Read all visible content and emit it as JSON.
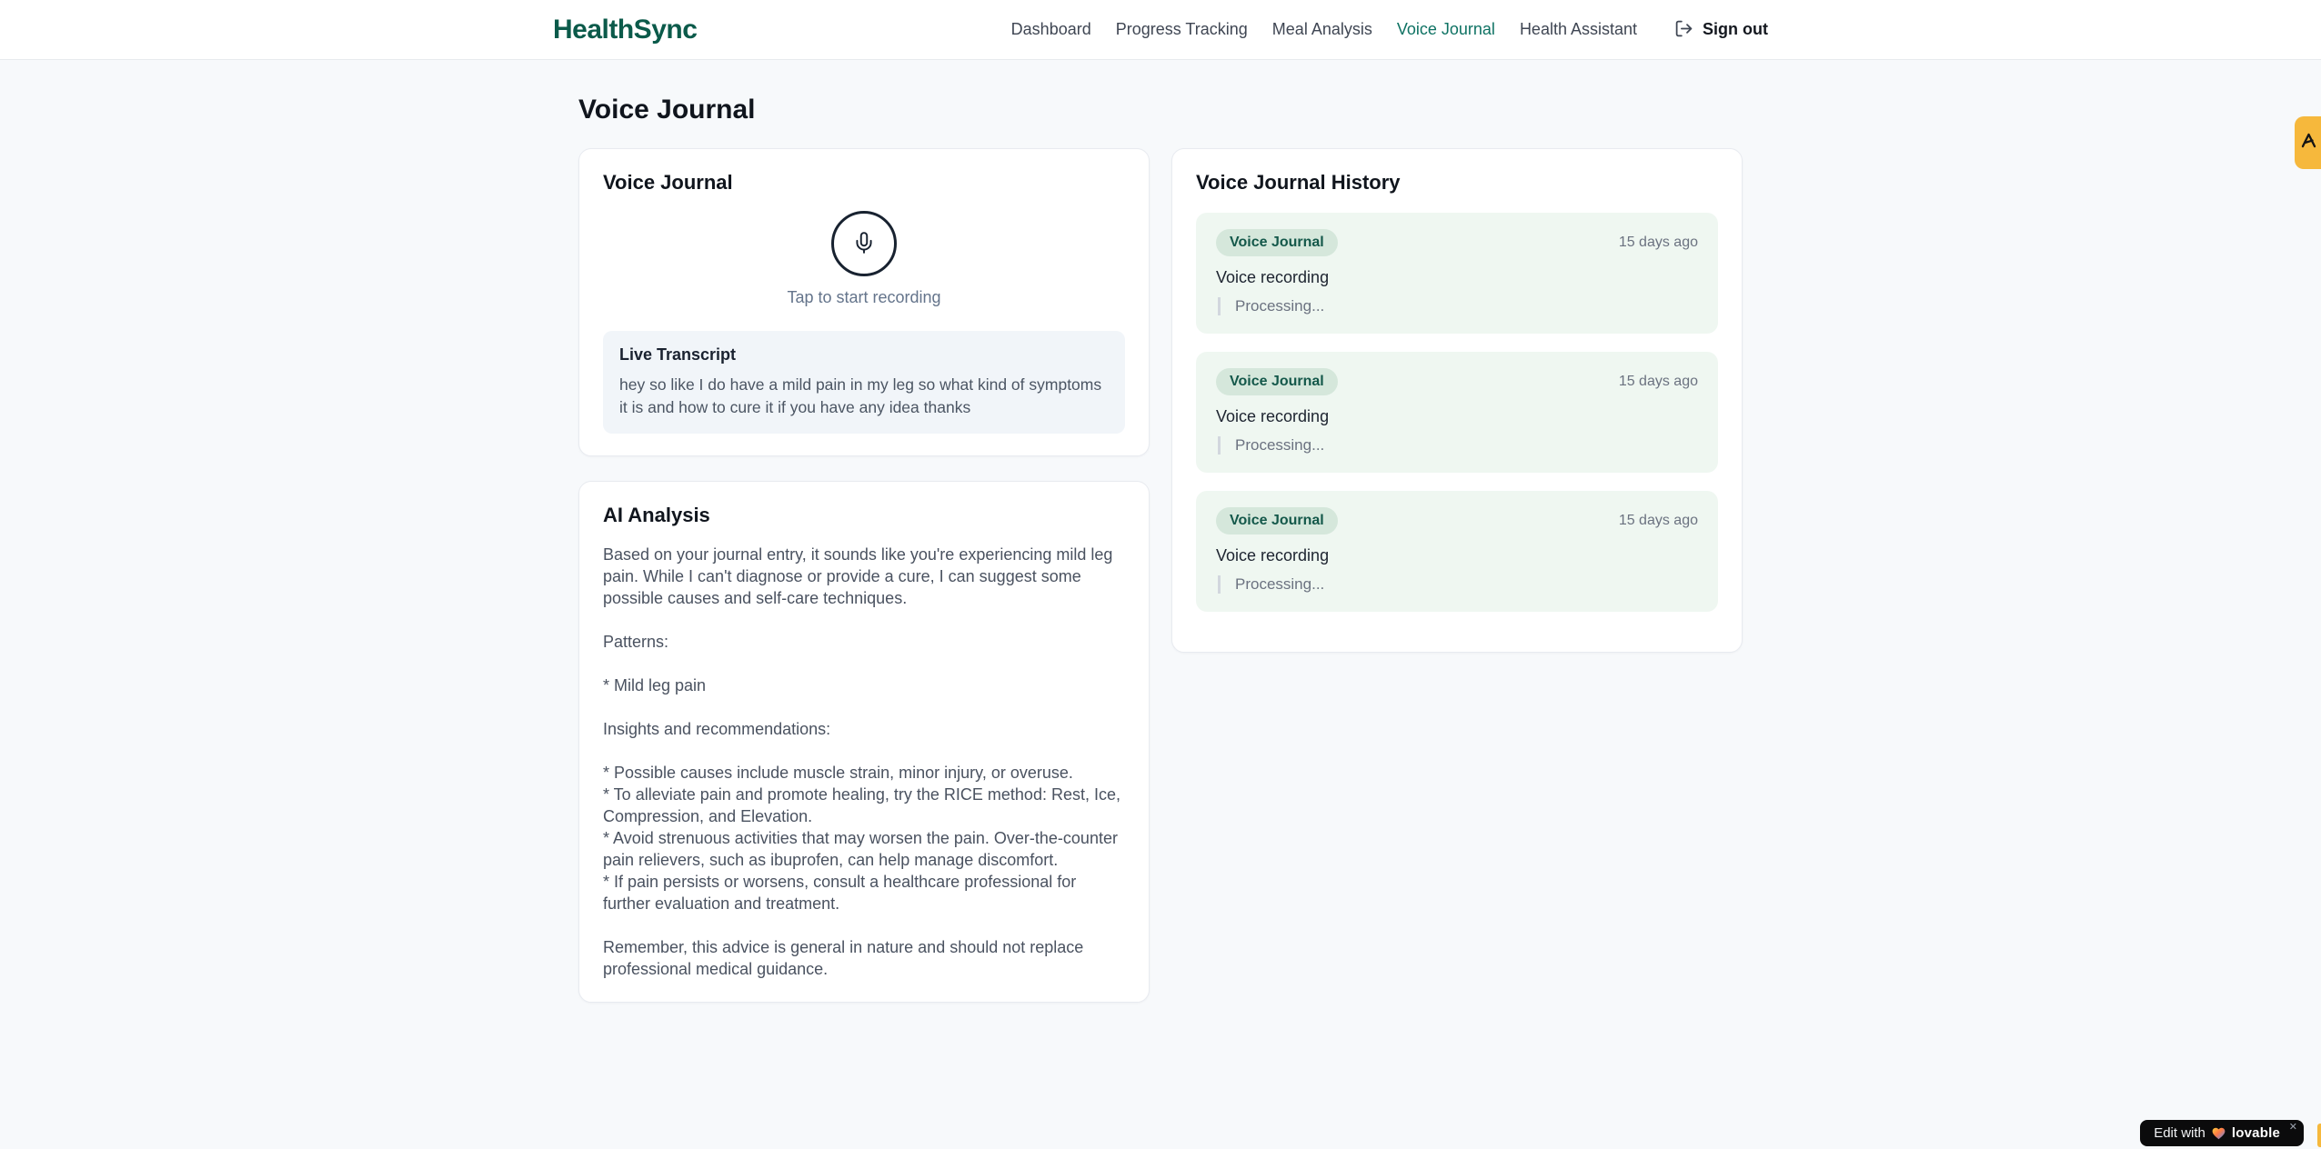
{
  "brand": {
    "name": "HealthSync"
  },
  "nav": {
    "items": [
      {
        "label": "Dashboard",
        "active": false
      },
      {
        "label": "Progress Tracking",
        "active": false
      },
      {
        "label": "Meal Analysis",
        "active": false
      },
      {
        "label": "Voice Journal",
        "active": true
      },
      {
        "label": "Health Assistant",
        "active": false
      }
    ],
    "signout_label": "Sign out"
  },
  "page": {
    "title": "Voice Journal"
  },
  "recorder_card": {
    "title": "Voice Journal",
    "tap_label": "Tap to start recording",
    "transcript_title": "Live Transcript",
    "transcript_text": "hey so like I do have a mild pain in my leg so what kind of symptoms it is and how to cure it if you have any idea thanks"
  },
  "analysis_card": {
    "title": "AI Analysis",
    "body": "Based on your journal entry, it sounds like you're experiencing mild leg pain. While I can't diagnose or provide a cure, I can suggest some possible causes and self-care techniques.\n\nPatterns:\n\n* Mild leg pain\n\nInsights and recommendations:\n\n* Possible causes include muscle strain, minor injury, or overuse.\n* To alleviate pain and promote healing, try the RICE method: Rest, Ice, Compression, and Elevation.\n* Avoid strenuous activities that may worsen the pain. Over-the-counter pain relievers, such as ibuprofen, can help manage discomfort.\n* If pain persists or worsens, consult a healthcare professional for further evaluation and treatment.\n\nRemember, this advice is general in nature and should not replace professional medical guidance."
  },
  "history_card": {
    "title": "Voice Journal History",
    "entries": [
      {
        "badge": "Voice Journal",
        "timestamp": "15 days ago",
        "title": "Voice recording",
        "status": "Processing..."
      },
      {
        "badge": "Voice Journal",
        "timestamp": "15 days ago",
        "title": "Voice recording",
        "status": "Processing..."
      },
      {
        "badge": "Voice Journal",
        "timestamp": "15 days ago",
        "title": "Voice recording",
        "status": "Processing..."
      }
    ]
  },
  "overlays": {
    "lovable": {
      "prefix": "Edit with",
      "brand": "lovable",
      "close": "✕"
    }
  },
  "colors": {
    "brand_teal": "#0b5a4a",
    "active_nav_teal": "#0e7263",
    "history_entry_bg": "#eff7f1",
    "badge_bg": "#d5e7db",
    "badge_text": "#14584a",
    "edge_badge_yellow": "#f6b83c",
    "transcript_bg": "#f1f5f9"
  }
}
